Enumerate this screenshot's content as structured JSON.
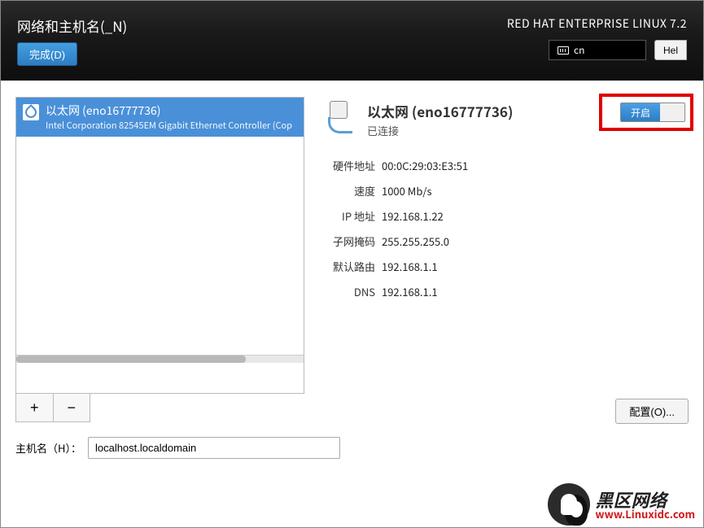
{
  "header": {
    "title": "网络和主机名(_N)",
    "done_label": "完成(D)",
    "product": "RED HAT ENTERPRISE LINUX 7.2",
    "lang_indicator": "cn",
    "help_label": "Hel"
  },
  "device_list": {
    "selected": {
      "name": "以太网 (eno16777736)",
      "subtitle": "Intel Corporation 82545EM Gigabit Ethernet Controller (Cop"
    },
    "add_label": "+",
    "remove_label": "−"
  },
  "connection": {
    "title": "以太网 (eno16777736)",
    "status": "已连接",
    "switch_on_label": "开启",
    "props": [
      {
        "label": "硬件地址",
        "value": "00:0C:29:03:E3:51"
      },
      {
        "label": "速度",
        "value": "1000 Mb/s"
      },
      {
        "label": "IP 地址",
        "value": "192.168.1.22"
      },
      {
        "label": "子网掩码",
        "value": "255.255.255.0"
      },
      {
        "label": "默认路由",
        "value": "192.168.1.1"
      },
      {
        "label": "DNS",
        "value": "192.168.1.1"
      }
    ],
    "config_label": "配置(O)..."
  },
  "hostname": {
    "label": "主机名（H）：",
    "value": "localhost.localdomain"
  },
  "watermark": {
    "text": "黑区网络",
    "sub": "www.Linuxidc.com"
  }
}
